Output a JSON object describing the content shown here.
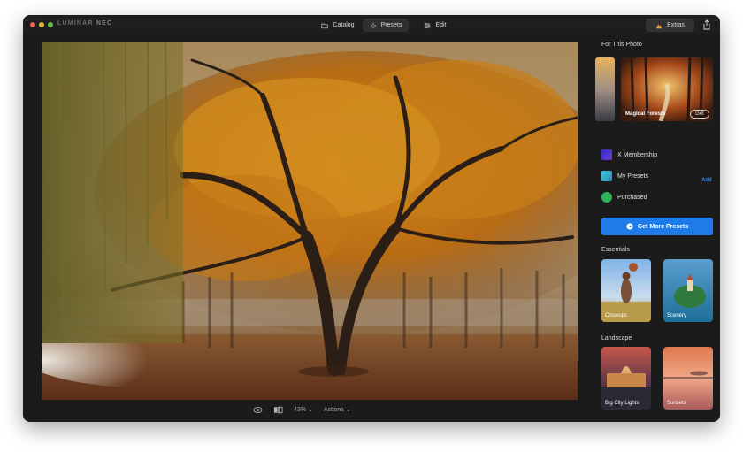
{
  "app": {
    "logo_main": "LUMINAR",
    "logo_sub": "NEO"
  },
  "topnav": {
    "catalog": "Catalog",
    "presets": "Presets",
    "edit": "Edit",
    "extras": "Extras"
  },
  "viewer": {
    "zoom": "43%",
    "actions": "Actions"
  },
  "panel": {
    "for_this_photo": "For This Photo",
    "featured": {
      "label": "Magical Forests",
      "get": "Get"
    },
    "collections": [
      {
        "label": "X Membership",
        "icon": "x-membership-icon"
      },
      {
        "label": "My Presets",
        "icon": "my-presets-icon"
      },
      {
        "label": "Purchased",
        "icon": "purchased-icon"
      }
    ],
    "add": "Add",
    "get_more": "Get More Presets",
    "essentials": {
      "title": "Essentials",
      "tiles": [
        "Closeups",
        "Scenery"
      ]
    },
    "landscape": {
      "title": "Landscape",
      "tiles": [
        "Big City Lights",
        "Sunsets"
      ]
    }
  },
  "colors": {
    "accent": "#1f7be8",
    "window_bg": "#1b1b1c",
    "add_link": "#3d8cf0"
  }
}
